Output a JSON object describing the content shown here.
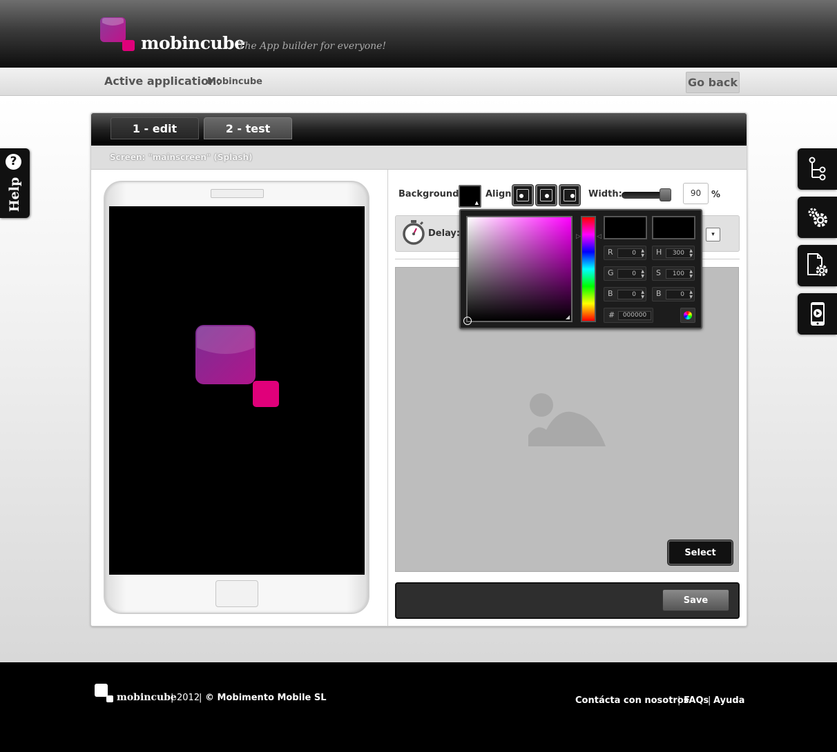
{
  "header": {
    "brand": "mobincube",
    "tagline": "The App builder for everyone!"
  },
  "appbar": {
    "label": "Active application:",
    "value": "Mobincube",
    "go_back": "Go back"
  },
  "help": {
    "icon_glyph": "?",
    "label": "Help"
  },
  "side_tools": [
    {
      "name": "tree-structure-icon"
    },
    {
      "name": "settings-gears-icon"
    },
    {
      "name": "document-settings-icon"
    },
    {
      "name": "mobile-preview-icon"
    }
  ],
  "tabs": {
    "edit": "1 - edit",
    "test": "2 - test"
  },
  "screen": {
    "title": "Screen: \"mainscreen\" (Splash)"
  },
  "controls": {
    "background_label": "Background:",
    "align_label": "Align:",
    "width_label": "Width:",
    "width_value": "90",
    "width_fraction": 0.9,
    "percent_sign": "%",
    "delay_label": "Delay:",
    "dropdown_glyph": "▾",
    "select_label": "Select",
    "save_label": "Save"
  },
  "color_picker": {
    "rgb": [
      {
        "key": "R",
        "value": "0"
      },
      {
        "key": "G",
        "value": "0"
      },
      {
        "key": "B",
        "value": "0"
      }
    ],
    "hsb": [
      {
        "key": "H",
        "value": "300"
      },
      {
        "key": "S",
        "value": "100"
      },
      {
        "key": "B",
        "value": "0"
      }
    ],
    "hex_key": "#",
    "hex_value": "000000",
    "current_color": "#000000",
    "hue_color": "#ff00ff"
  },
  "footer": {
    "brand": "mobincube",
    "year": "2012",
    "copyright": "© Mobimento Mobile SL",
    "links": [
      "Contácta con nosotros",
      "FAQs",
      "Ayuda"
    ],
    "separator": "|"
  },
  "colors": {
    "brand_purple": "#7b2d8e",
    "brand_pink": "#e0007a",
    "header_dark": "#0d0d0d"
  }
}
